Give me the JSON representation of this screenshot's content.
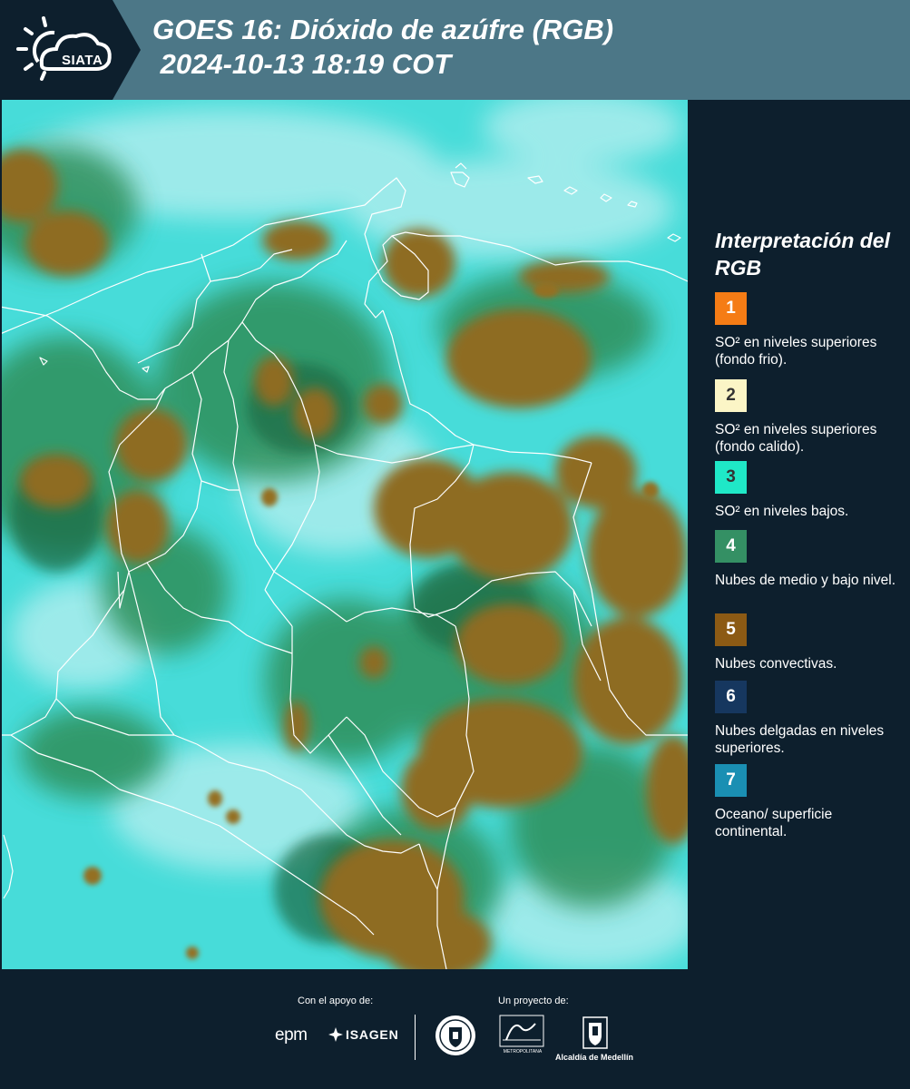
{
  "header": {
    "logo_text": "SIATA",
    "title": "GOES 16: Dióxido de azúfre (RGB)\n 2024-10-13 18:19 COT"
  },
  "map": {
    "satellite": "GOES 16",
    "product": "Dióxido de azúfre (RGB)",
    "colors": {
      "background_cyan": "#47dcd9",
      "pale_cyan": "#a6ecec",
      "green": "#2f8f5a",
      "convective_brown": "#8e6c24",
      "boundaries": "#ffffff"
    }
  },
  "legend": {
    "title": "Interpretación del RGB",
    "items": [
      {
        "number": "1",
        "color": "#f57c15",
        "text_color": "#ffffff",
        "description": "SO² en niveles superiores (fondo frio)."
      },
      {
        "number": "2",
        "color": "#fbf5c6",
        "text_color": "#333333",
        "description": "SO² en niveles superiores (fondo calido)."
      },
      {
        "number": "3",
        "color": "#1fe8c7",
        "text_color": "#333333",
        "description": "SO² en niveles bajos."
      },
      {
        "number": "4",
        "color": "#349064",
        "text_color": "#ffffff",
        "description": "Nubes de medio y bajo nivel."
      },
      {
        "number": "5",
        "color": "#8c5a14",
        "text_color": "#ffffff",
        "description": "Nubes convectivas."
      },
      {
        "number": "6",
        "color": "#16375f",
        "text_color": "#ffffff",
        "description": "Nubes delgadas en niveles superiores."
      },
      {
        "number": "7",
        "color": "#1a8fb3",
        "text_color": "#ffffff",
        "description": "Oceano/ superficie continental."
      }
    ]
  },
  "footer": {
    "support_label": "Con el apoyo de:",
    "project_label": "Un proyecto de:",
    "epm": "epm",
    "isagen": "ISAGEN",
    "metro_name": "METROPOLITANA",
    "alcaldia": "Alcaldía de Medellín"
  }
}
